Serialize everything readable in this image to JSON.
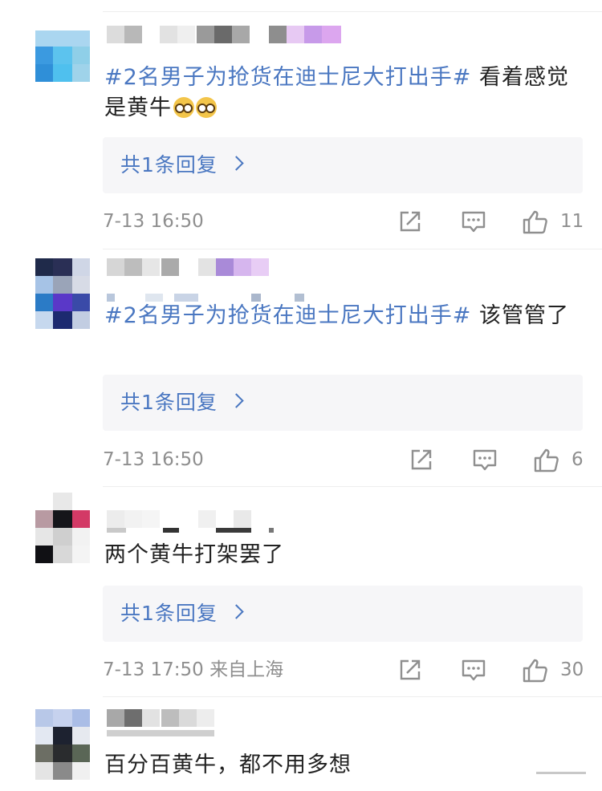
{
  "comments": [
    {
      "topic": "#2名男子为抢货在迪士尼大打出手#",
      "text": " 看着感觉是黄牛",
      "emojis": [
        "eyes-emoji",
        "eyes-emoji"
      ],
      "reply": "共1条回复",
      "time": "7-13 16:50",
      "likes": "11"
    },
    {
      "topic": "#2名男子为抢货在迪士尼大打出手#",
      "text": "  该管管了",
      "reply": "共1条回复",
      "time": "7-13 16:50",
      "likes": "6"
    },
    {
      "topic": "",
      "text": "两个黄牛打架罢了",
      "reply": "共1条回复",
      "time": "7-13 17:50 来自上海",
      "likes": "30"
    },
    {
      "topic": "",
      "text": "百分百黄牛，都不用多想"
    }
  ],
  "icons": {
    "share": "share-icon",
    "comment": "comment-icon",
    "like": "thumbs-up-icon"
  },
  "colors": {
    "topic": "#4a77c1",
    "meta": "#8f8f8f",
    "reply_bg": "#f6f6f8"
  }
}
